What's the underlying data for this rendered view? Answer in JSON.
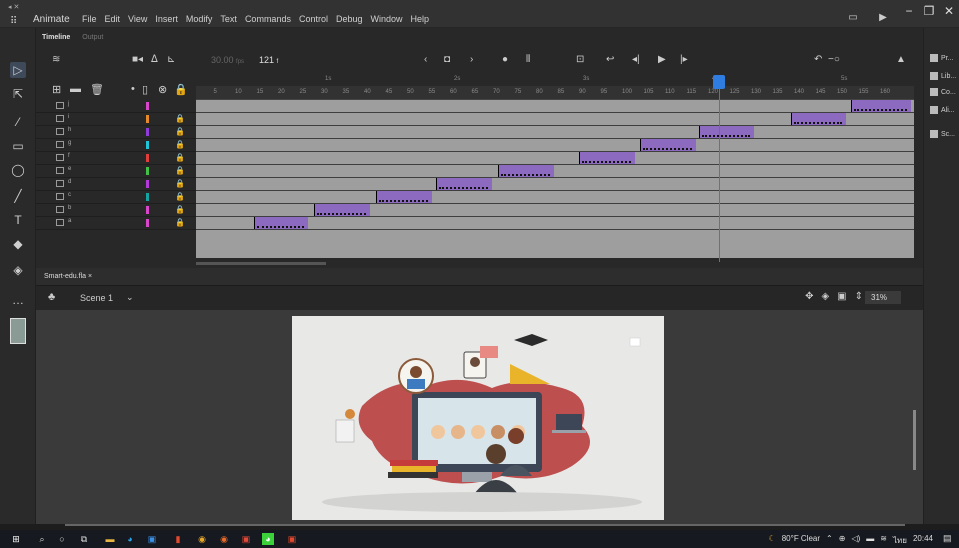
{
  "app": {
    "name": "Animate",
    "menu": [
      "File",
      "Edit",
      "View",
      "Insert",
      "Modify",
      "Text",
      "Commands",
      "Control",
      "Debug",
      "Window",
      "Help"
    ]
  },
  "timeline": {
    "tabs": [
      "Timeline",
      "Output"
    ],
    "fps": "30.00",
    "fps_unit": "fps",
    "current_frame": "121",
    "frame_unit": "f",
    "ruler_numbers": [
      "5",
      "10",
      "15",
      "20",
      "25",
      "30",
      "35",
      "40",
      "45",
      "50",
      "55",
      "60",
      "65",
      "70",
      "75",
      "80",
      "85",
      "90",
      "95",
      "100",
      "105",
      "110",
      "115",
      "120",
      "125",
      "130",
      "135",
      "140",
      "145",
      "150",
      "155",
      "160"
    ],
    "seconds_marks": [
      "1s",
      "2s",
      "3s",
      "4s",
      "5s"
    ],
    "layers": [
      {
        "name": "j",
        "color": "#d946c9",
        "locked": false
      },
      {
        "name": "i",
        "color": "#e58a2b",
        "locked": true
      },
      {
        "name": "h",
        "color": "#8f3dd8",
        "locked": true
      },
      {
        "name": "g",
        "color": "#1fc4d6",
        "locked": true
      },
      {
        "name": "f",
        "color": "#e03d3d",
        "locked": true
      },
      {
        "name": "e",
        "color": "#42c148",
        "locked": true
      },
      {
        "name": "d",
        "color": "#b23ad9",
        "locked": true
      },
      {
        "name": "c",
        "color": "#13a3a0",
        "locked": true
      },
      {
        "name": "b",
        "color": "#d946c9",
        "locked": true
      },
      {
        "name": "a",
        "color": "#d946c9",
        "locked": true
      }
    ]
  },
  "document": {
    "tab_name": "Smart-edu.fla",
    "scene": "Scene 1",
    "zoom": "31%"
  },
  "right_panel": [
    "Pr...",
    "Lib...",
    "Co...",
    "Ali...",
    "Sc..."
  ],
  "taskbar": {
    "weather": "80°F  Clear",
    "lang": "ไทย",
    "time": "20:44"
  }
}
